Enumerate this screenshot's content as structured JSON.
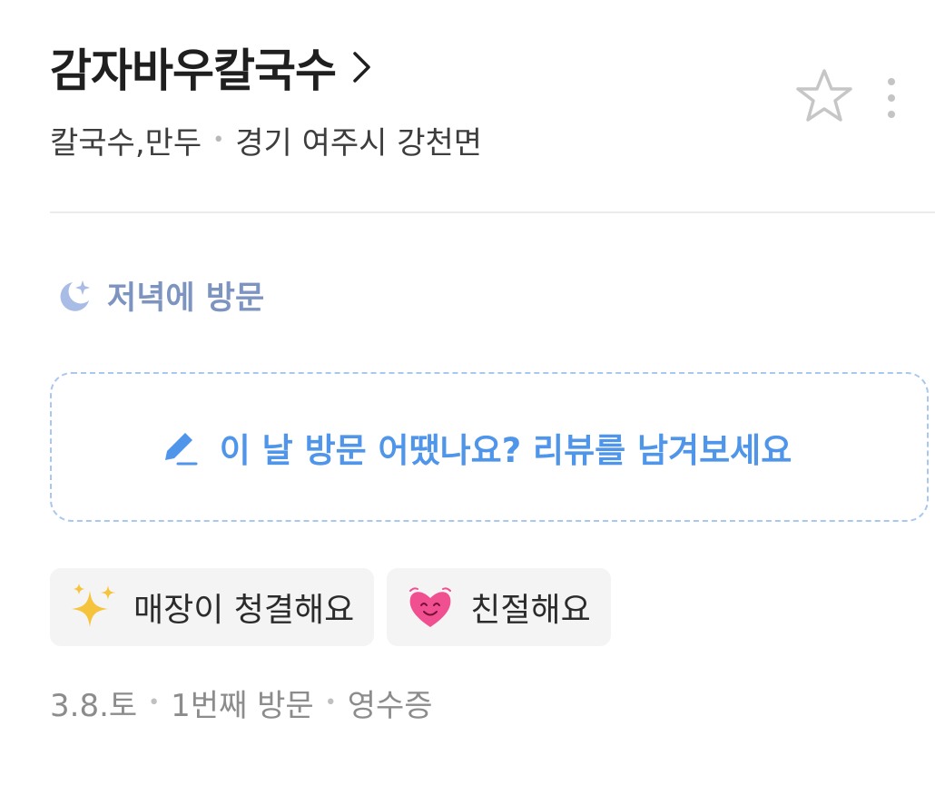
{
  "header": {
    "title": "감자바우칼국수",
    "category": "칼국수,만두",
    "location": "경기 여주시 강천면"
  },
  "visit": {
    "time_label": "저녁에 방문"
  },
  "review_prompt": {
    "text": "이 날 방문 어땠나요? 리뷰를 남겨보세요"
  },
  "tags": [
    {
      "icon": "sparkles-icon",
      "label": "매장이 청결해요"
    },
    {
      "icon": "smiling-heart-icon",
      "label": "친절해요"
    }
  ],
  "footer": {
    "date": "3.8.토",
    "visit_count": "1번째 방문",
    "proof": "영수증"
  },
  "colors": {
    "title": "#1f1f1f",
    "visit_time": "#7d93c0",
    "review_accent": "#4f95e9",
    "review_border": "#a9c8ef",
    "chip_bg": "#f4f4f5",
    "meta_text": "#8c8c8c"
  }
}
